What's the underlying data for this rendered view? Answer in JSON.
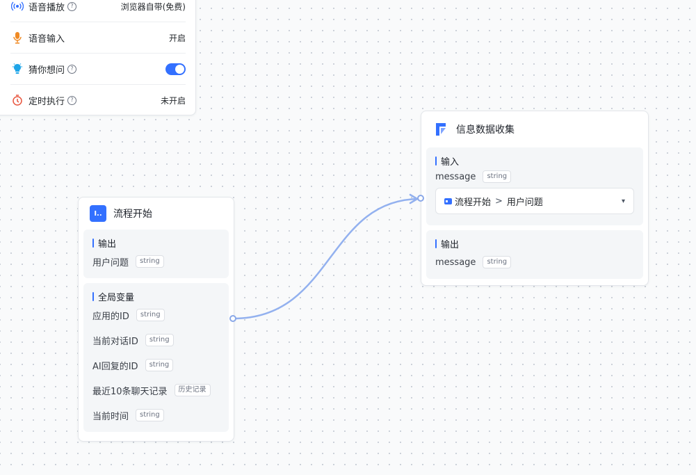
{
  "settings": {
    "items": [
      {
        "label": "语音播放",
        "value": "浏览器自带(免费)",
        "icon": "speaker-icon",
        "help": "?"
      },
      {
        "label": "语音输入",
        "value": "开启",
        "icon": "microphone-icon"
      },
      {
        "label": "猜你想问",
        "value": "",
        "icon": "lightbulb-icon",
        "help": "?",
        "toggle_on": true
      },
      {
        "label": "定时执行",
        "value": "未开启",
        "icon": "timer-icon",
        "help": "?"
      }
    ]
  },
  "start_node": {
    "title": "流程开始",
    "icon_text": "I..",
    "output_title": "输出",
    "outputs": [
      {
        "name": "用户问题",
        "type": "string"
      }
    ],
    "globals_title": "全局变量",
    "globals": [
      {
        "name": "应用的ID",
        "type": "string"
      },
      {
        "name": "当前对话ID",
        "type": "string"
      },
      {
        "name": "AI回复的ID",
        "type": "string"
      },
      {
        "name": "最近10条聊天记录",
        "type": "历史记录"
      },
      {
        "name": "当前时间",
        "type": "string"
      }
    ]
  },
  "collect_node": {
    "title": "信息数据收集",
    "input_title": "输入",
    "input_field": {
      "name": "message",
      "type": "string"
    },
    "select": {
      "source": "流程开始",
      "separator": ">",
      "field": "用户问题"
    },
    "output_title": "输出",
    "output_field": {
      "name": "message",
      "type": "string"
    }
  },
  "colors": {
    "accent": "#3370ff",
    "edge": "#93b1ef"
  }
}
